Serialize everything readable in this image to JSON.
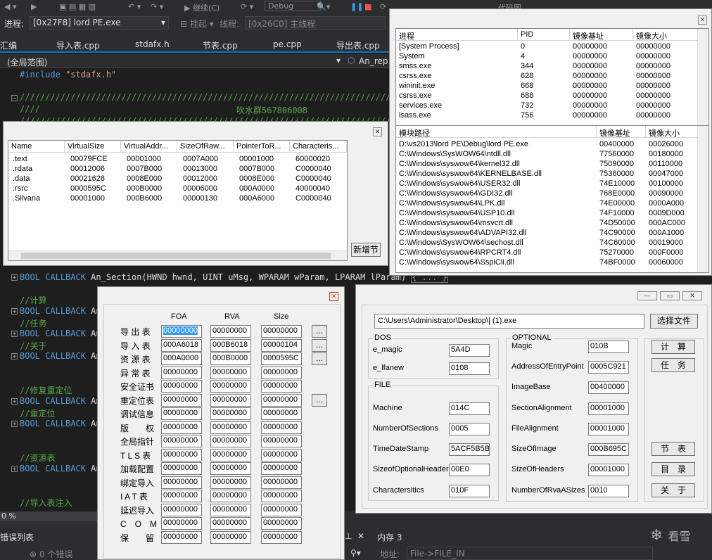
{
  "ide": {
    "toolbar": {
      "continue_label": "继续(C)",
      "config_value": "Debug",
      "code_map_label": "代码图"
    },
    "process": {
      "label": "进程:",
      "value": "[0x27F8] lord PE.exe",
      "lifecycle_label": "挂起",
      "thread_label": "线程:",
      "thread_value": "[0x26C0] 主线程"
    },
    "tabs": [
      "汇编",
      "导入表.cpp",
      "stdafx.h",
      "节表.cpp",
      "pe.cpp",
      "导出表.cpp"
    ],
    "scope": "(全局范围)",
    "member": "An_rep",
    "code": {
      "include_kw": "#include",
      "include_file": "\"stdafx.h\"",
      "slashes": "////////////////////////////////////////////////////////////////////////////////////////////////////////",
      "comment_prefix": "////",
      "group": "吹水群567806008",
      "fn_sig_kw1": "BOOL",
      "fn_sig_kw2": "CALLBACK",
      "fn_name": "An_Section",
      "fn_params": "(HWND hwnd, UINT uMsg, WPARAM wParam, LPARAM lParam)",
      "fn_ellipsis": "{ ... }",
      "fn_trunc": "An",
      "c_calc": "//计算",
      "c_task": "//任务",
      "c_about": "//关于",
      "c_fix": "//修复重定位",
      "c_reloc": "//重定位",
      "c_res": "//资源表",
      "c_imp": "//导入表注入"
    },
    "zoom": "0 %",
    "error_list": "错误列表",
    "errors": "0 个错误",
    "memory": "内存 3",
    "address_label": "地址:",
    "address_value": "File->FILE_IN",
    "watermark": "看雪"
  },
  "sections_window": {
    "columns": [
      "Name",
      "VirtualSize",
      "VirtualAddr...",
      "SizeOfRaw...",
      "PointerToR...",
      "Characteris..."
    ],
    "rows": [
      [
        ".text",
        "00079FCE",
        "00001000",
        "0007A000",
        "00001000",
        "60000020"
      ],
      [
        ".rdata",
        "00012006",
        "0007B000",
        "00013000",
        "0007B000",
        "C0000040"
      ],
      [
        ".data",
        "00021628",
        "0008E000",
        "00012000",
        "0008E000",
        "C0000040"
      ],
      [
        ".rsrc",
        "0000595C",
        "000B0000",
        "00006000",
        "000A0000",
        "40000040"
      ],
      [
        ".Silvana",
        "00001000",
        "000B6000",
        "00000130",
        "000A6000",
        "C0000040"
      ]
    ],
    "add_button": "新增节"
  },
  "process_window": {
    "proc_columns": [
      "进程",
      "PID",
      "镜像基址",
      "镜像大小"
    ],
    "processes": [
      [
        "[System Process]",
        "0",
        "00000000",
        "00000000"
      ],
      [
        "System",
        "4",
        "00000000",
        "00000000"
      ],
      [
        "smss.exe",
        "344",
        "00000000",
        "00000000"
      ],
      [
        "csrss.exe",
        "628",
        "00000000",
        "00000000"
      ],
      [
        "wininit.exe",
        "668",
        "00000000",
        "00000000"
      ],
      [
        "csrss.exe",
        "688",
        "00000000",
        "00000000"
      ],
      [
        "services.exe",
        "732",
        "00000000",
        "00000000"
      ],
      [
        "lsass.exe",
        "756",
        "00000000",
        "00000000"
      ]
    ],
    "mod_columns": [
      "模块路径",
      "镜像基址",
      "镜像大小"
    ],
    "modules": [
      [
        "D:\\vs2013\\lord PE\\Debug\\lord PE.exe",
        "00400000",
        "00026000"
      ],
      [
        "C:\\Windows\\SysWOW64\\ntdll.dll",
        "77560000",
        "00180000"
      ],
      [
        "C:\\Windows\\syswow64\\kernel32.dll",
        "75090000",
        "00110000"
      ],
      [
        "C:\\Windows\\syswow64\\KERNELBASE.dll",
        "75360000",
        "00047000"
      ],
      [
        "C:\\Windows\\syswow64\\USER32.dll",
        "74E10000",
        "00100000"
      ],
      [
        "C:\\Windows\\syswow64\\GDI32.dll",
        "768E0000",
        "00090000"
      ],
      [
        "C:\\Windows\\syswow64\\LPK.dll",
        "74E00000",
        "0000A000"
      ],
      [
        "C:\\Windows\\syswow64\\USP10.dll",
        "74F10000",
        "0009D000"
      ],
      [
        "C:\\Windows\\syswow64\\msvcrt.dll",
        "74D50000",
        "000AC000"
      ],
      [
        "C:\\Windows\\syswow64\\ADVAPI32.dll",
        "74C90000",
        "000A1000"
      ],
      [
        "C:\\Windows\\SysWOW64\\sechost.dll",
        "74C60000",
        "00019000"
      ],
      [
        "C:\\Windows\\syswow64\\RPCRT4.dll",
        "75270000",
        "000F0000"
      ],
      [
        "C:\\Windows\\syswow64\\SspiCli.dll",
        "74BF0000",
        "00060000"
      ]
    ]
  },
  "directory_window": {
    "col_foa": "FOA",
    "col_rva": "RVA",
    "col_size": "Size",
    "rows": [
      {
        "label": "导 出 表",
        "foa": "00000000",
        "rva": "00000000",
        "size": "00000000",
        "more": true
      },
      {
        "label": "导 入 表",
        "foa": "000A6018",
        "rva": "000B6018",
        "size": "00000104",
        "more": true
      },
      {
        "label": "资 源 表",
        "foa": "000A0000",
        "rva": "000B0000",
        "size": "0000595C",
        "more": true
      },
      {
        "label": "异 常 表",
        "foa": "00000000",
        "rva": "00000000",
        "size": "00000000",
        "more": false
      },
      {
        "label": "安全证书",
        "foa": "00000000",
        "rva": "00000000",
        "size": "00000000",
        "more": false
      },
      {
        "label": "重定位表",
        "foa": "00000000",
        "rva": "00000000",
        "size": "00000000",
        "more": true
      },
      {
        "label": "调试信息",
        "foa": "00000000",
        "rva": "00000000",
        "size": "00000000",
        "more": false
      },
      {
        "label": "版　　权",
        "foa": "00000000",
        "rva": "00000000",
        "size": "00000000",
        "more": false
      },
      {
        "label": "全局指针",
        "foa": "00000000",
        "rva": "00000000",
        "size": "00000000",
        "more": false
      },
      {
        "label": "T L S 表",
        "foa": "00000000",
        "rva": "00000000",
        "size": "00000000",
        "more": false
      },
      {
        "label": "加载配置",
        "foa": "00000000",
        "rva": "00000000",
        "size": "00000000",
        "more": false
      },
      {
        "label": "绑定导入",
        "foa": "00000000",
        "rva": "00000000",
        "size": "00000000",
        "more": false
      },
      {
        "label": "I A T 表",
        "foa": "00000000",
        "rva": "00000000",
        "size": "00000000",
        "more": false
      },
      {
        "label": "延迟导入",
        "foa": "00000000",
        "rva": "00000000",
        "size": "00000000",
        "more": false
      },
      {
        "label": "C　O　M",
        "foa": "00000000",
        "rva": "00000000",
        "size": "00000000",
        "more": false
      },
      {
        "label": "保　　留",
        "foa": "00000000",
        "rva": "00000000",
        "size": "00000000",
        "more": false
      }
    ],
    "more_label": "..."
  },
  "pe_window": {
    "path": "C:\\Users\\Administrator\\Desktop\\| (1).exe",
    "choose_file": "选择文件",
    "dos_title": "DOS",
    "file_title": "FILE",
    "optional_title": "OPTIONAL",
    "dos": [
      {
        "label": "e_magic",
        "value": "5A4D"
      },
      {
        "label": "e_lfanew",
        "value": "0108"
      }
    ],
    "file": [
      {
        "label": "Machine",
        "value": "014C"
      },
      {
        "label": "NumberOfSections",
        "value": "0005"
      },
      {
        "label": "TimeDateStamp",
        "value": "5ACF5B5B"
      },
      {
        "label": "SizeofOptionalHeader",
        "value": "00E0"
      },
      {
        "label": "Charactersitics",
        "value": "010F"
      }
    ],
    "optional": [
      {
        "label": "Magic",
        "value": "010B"
      },
      {
        "label": "AddressOfEntryPoint",
        "value": "0005C921"
      },
      {
        "label": "ImageBase",
        "value": "00400000"
      },
      {
        "label": "SectionAlignment",
        "value": "00001000"
      },
      {
        "label": "FileAlignment",
        "value": "00001000"
      },
      {
        "label": "SizeOfImage",
        "value": "000B695C"
      },
      {
        "label": "SizeOfHeaders",
        "value": "00001000"
      },
      {
        "label": "NumberOfRvaASizes",
        "value": "0010"
      }
    ],
    "buttons": {
      "calc": "计　算",
      "task": "任　务",
      "section": "节　表",
      "directory": "目　录",
      "about": "关　于"
    }
  }
}
